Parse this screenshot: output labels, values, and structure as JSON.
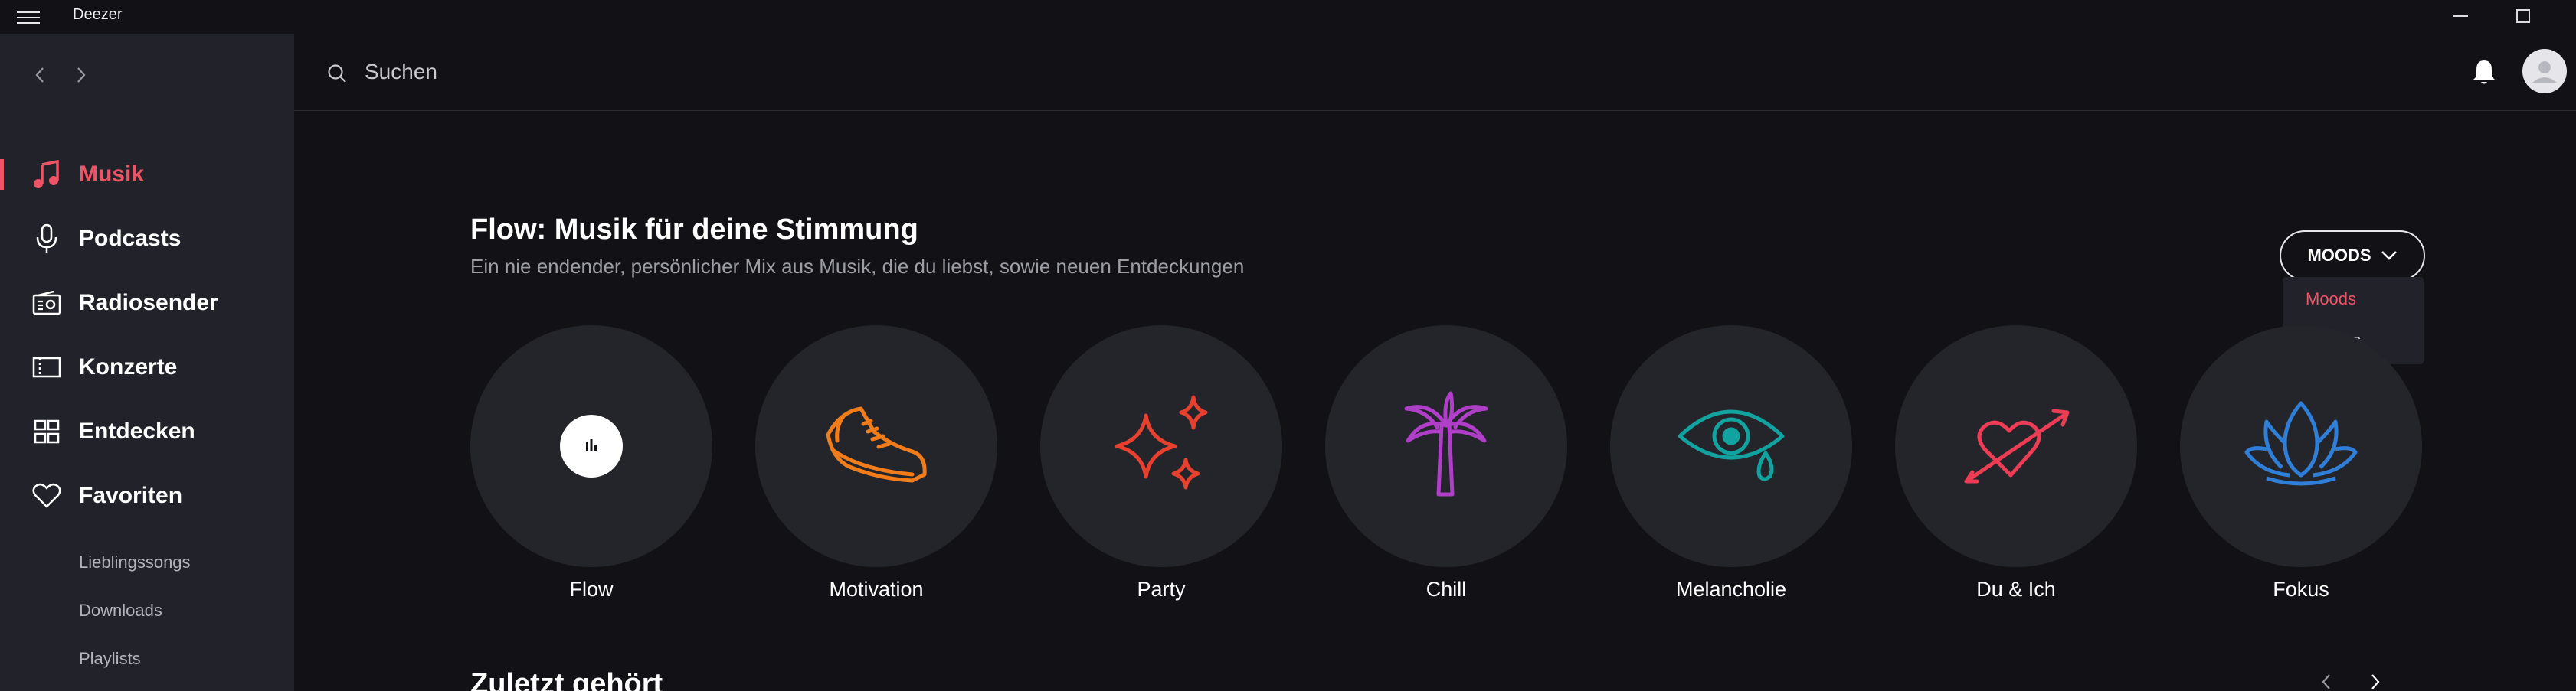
{
  "app": {
    "title": "Deezer"
  },
  "search": {
    "placeholder": "Suchen"
  },
  "sidebar": {
    "items": [
      {
        "label": "Musik",
        "icon": "music-note-icon",
        "active": true
      },
      {
        "label": "Podcasts",
        "icon": "microphone-icon"
      },
      {
        "label": "Radiosender",
        "icon": "radio-icon"
      },
      {
        "label": "Konzerte",
        "icon": "ticket-icon"
      },
      {
        "label": "Entdecken",
        "icon": "grid-icon"
      },
      {
        "label": "Favoriten",
        "icon": "heart-icon"
      }
    ],
    "sub_items": [
      "Lieblingssongs",
      "Downloads",
      "Playlists"
    ]
  },
  "section": {
    "title": "Flow: Musik für deine Stimmung",
    "subtitle": "Ein nie endender, persönlicher Mix aus Musik, die du liebst, sowie neuen Entdeckungen"
  },
  "moods_dropdown": {
    "button_label": "MOODS",
    "options": [
      "Moods",
      "Genres"
    ],
    "selected": "Moods"
  },
  "moods": [
    {
      "name": "Flow",
      "icon": "equalizer-icon"
    },
    {
      "name": "Motivation",
      "icon": "sneaker-icon",
      "color": "#f07d1a"
    },
    {
      "name": "Party",
      "icon": "sparkles-icon",
      "color": "#e8402e"
    },
    {
      "name": "Chill",
      "icon": "palm-tree-icon",
      "color": "#b13ec9"
    },
    {
      "name": "Melancholie",
      "icon": "crying-eye-icon",
      "color": "#12a3a0"
    },
    {
      "name": "Du & Ich",
      "icon": "heart-arrow-icon",
      "color": "#ec3d55"
    },
    {
      "name": "Fokus",
      "icon": "lotus-icon",
      "color": "#2f7fd8"
    }
  ],
  "recent": {
    "title": "Zuletzt gehört"
  },
  "colors": {
    "accent": "#ef5466",
    "background": "#121216",
    "sidebar": "#22222a"
  }
}
